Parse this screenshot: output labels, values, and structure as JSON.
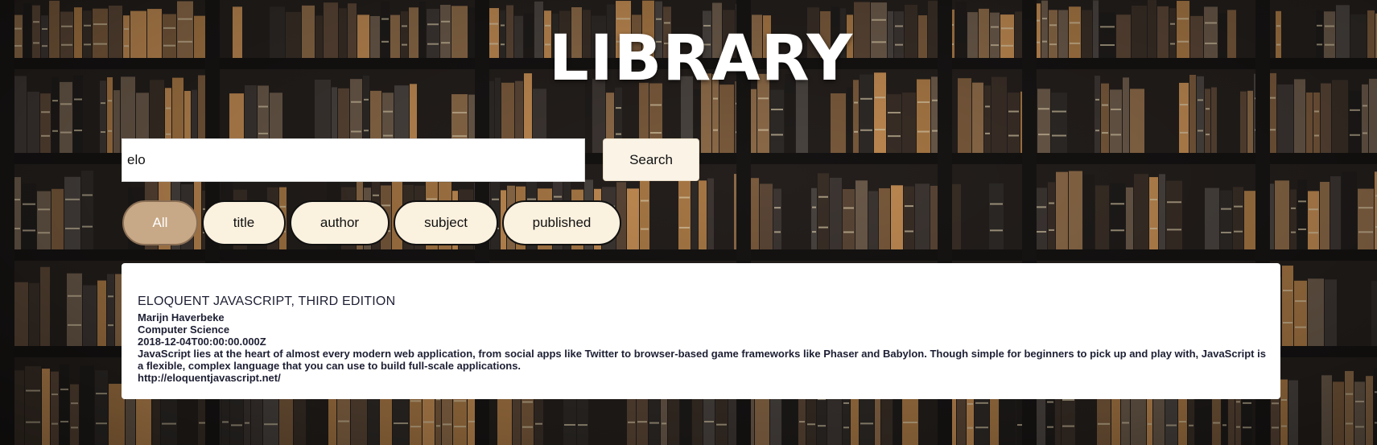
{
  "header": {
    "title": "LIBRARY"
  },
  "search": {
    "value": "elo",
    "button_label": "Search"
  },
  "filters": [
    {
      "label": "All",
      "active": true
    },
    {
      "label": "title",
      "active": false
    },
    {
      "label": "author",
      "active": false
    },
    {
      "label": "subject",
      "active": false
    },
    {
      "label": "published",
      "active": false
    }
  ],
  "results": [
    {
      "title": "ELOQUENT JAVASCRIPT, THIRD EDITION",
      "author": "Marijn Haverbeke",
      "subject": "Computer Science",
      "published": "2018-12-04T00:00:00.000Z",
      "description": "JavaScript lies at the heart of almost every modern web application, from social apps like Twitter to browser-based game frameworks like Phaser and Babylon. Though simple for beginners to pick up and play with, JavaScript is a flexible, complex language that you can use to build full-scale applications.",
      "url": "http://eloquentjavascript.net/"
    }
  ],
  "colors": {
    "active_pill": "#c8a987",
    "pill": "#fbf1df",
    "search_button": "#faf3e6",
    "result_text": "#1d1f33"
  }
}
